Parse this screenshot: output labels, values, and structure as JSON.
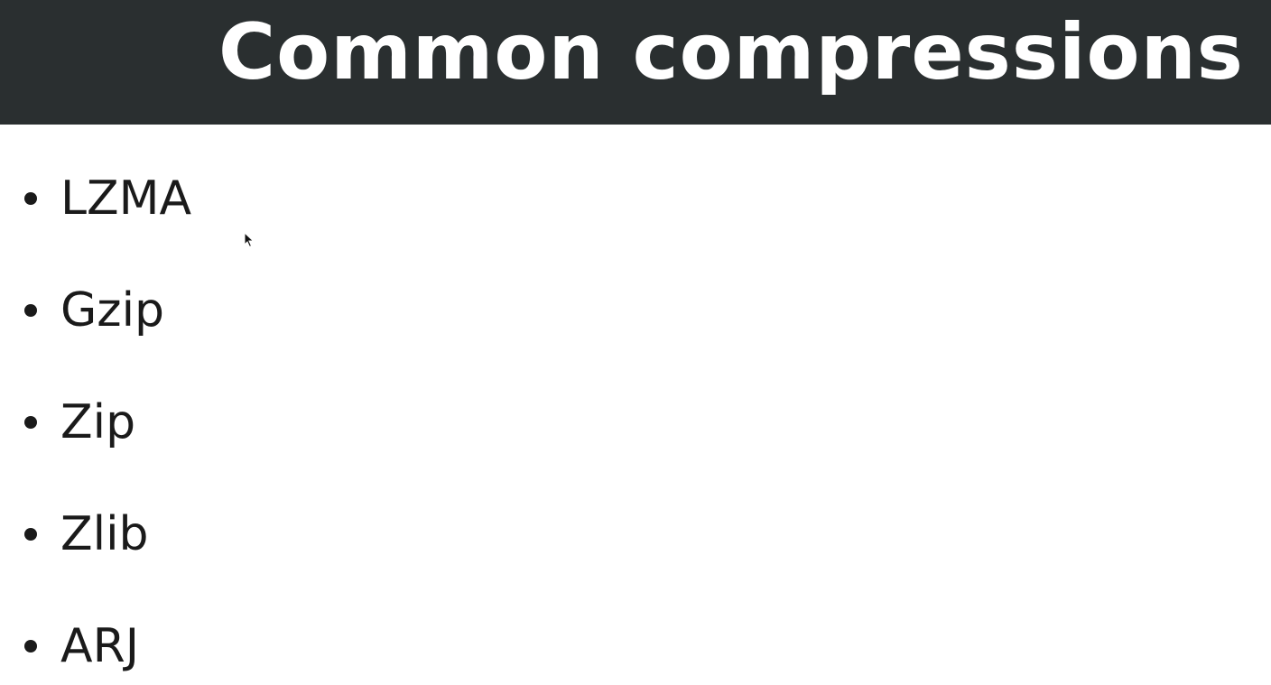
{
  "slide": {
    "title": "Common compressions",
    "bullets": [
      {
        "label": "LZMA"
      },
      {
        "label": "Gzip"
      },
      {
        "label": "Zip"
      },
      {
        "label": "Zlib"
      },
      {
        "label": "ARJ"
      }
    ]
  },
  "colors": {
    "title_bar": "#2a2f30",
    "title_text": "#ffffff",
    "body_text": "#1a1a1a",
    "background": "#ffffff"
  },
  "icons": {
    "cursor": "mouse-pointer-icon",
    "bullet": "bullet-dot-icon"
  }
}
